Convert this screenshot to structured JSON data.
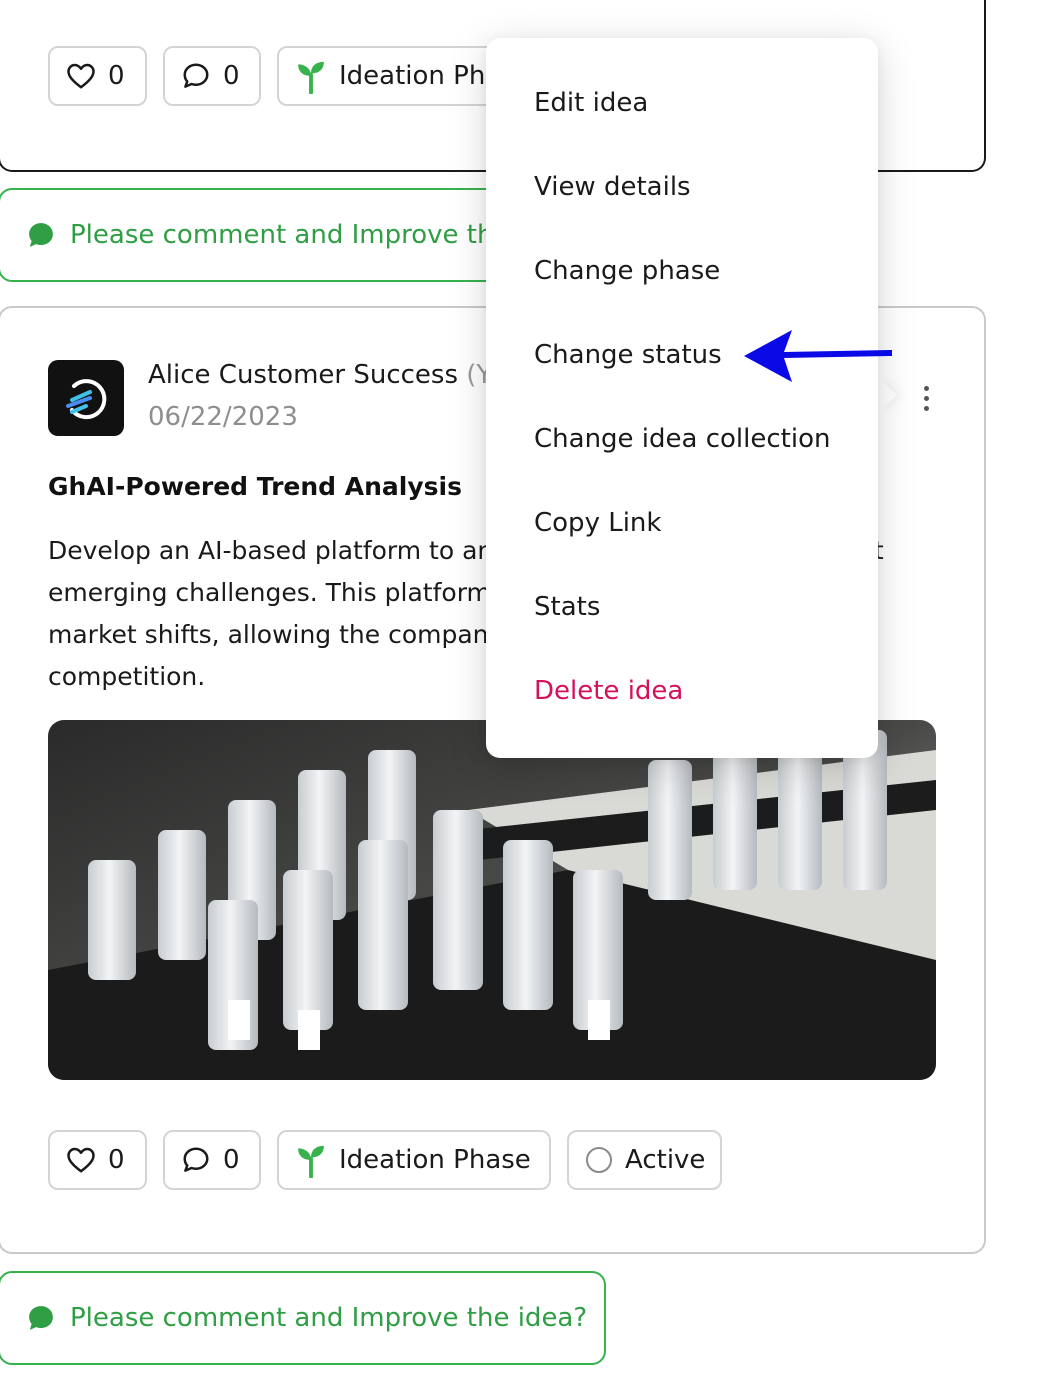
{
  "top_card": {
    "likes": "0",
    "comments": "0",
    "phase_label": "Ideation Phase"
  },
  "top_comment_prompt": "Please comment and Improve the idea?",
  "idea": {
    "author": "Alice Customer Success",
    "author_suffix": "(You)",
    "date": "06/22/2023",
    "title": "GhAI-Powered Trend Analysis",
    "description": "Develop an AI-based platform to analyze industry data and predict emerging challenges. This platform would provide insights into market shifts, allowing the company to stay ahead of the competition.",
    "likes": "0",
    "comments": "0",
    "phase_label": "Ideation Phase",
    "status_label": "Active"
  },
  "bottom_comment_prompt": "Please comment and Improve the idea?",
  "context_menu": {
    "items": [
      {
        "label": "Edit idea"
      },
      {
        "label": "View details"
      },
      {
        "label": "Change phase"
      },
      {
        "label": "Change status"
      },
      {
        "label": "Change idea collection"
      },
      {
        "label": "Copy Link"
      },
      {
        "label": "Stats"
      },
      {
        "label": "Delete idea"
      }
    ]
  },
  "colors": {
    "accent_green": "#37b24d",
    "danger": "#d6115c",
    "annotation_arrow": "#0a0ae6"
  },
  "icons": [
    "heart-icon",
    "comment-icon",
    "sprout-icon",
    "status-circle-icon",
    "chat-bubble-icon",
    "kebab-icon",
    "app-logo-icon"
  ]
}
